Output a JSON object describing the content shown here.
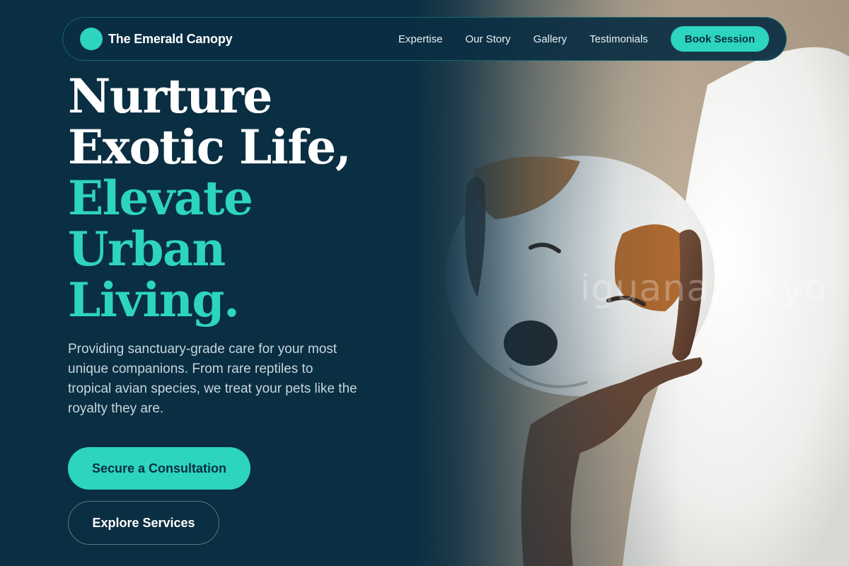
{
  "brand": {
    "name": "The Emerald Canopy"
  },
  "nav": {
    "links": [
      "Expertise",
      "Our Story",
      "Gallery",
      "Testimonials"
    ],
    "cta": "Book Session"
  },
  "hero": {
    "title_lines_white": [
      "Nurture",
      "Exotic Life,"
    ],
    "title_lines_teal": [
      "Elevate",
      "Urban",
      "Living."
    ],
    "description": "Providing sanctuary-grade care for your most unique companions. From rare reptiles to tropical avian species, we treat your pets like the royalty they are.",
    "primary_button": "Secure a Consultation",
    "secondary_button": "Explore Services",
    "image_watermark": "iguana.tokyo"
  },
  "colors": {
    "background": "#0a2e42",
    "accent": "#2dd4bf",
    "text_light": "#c7d6dd"
  }
}
